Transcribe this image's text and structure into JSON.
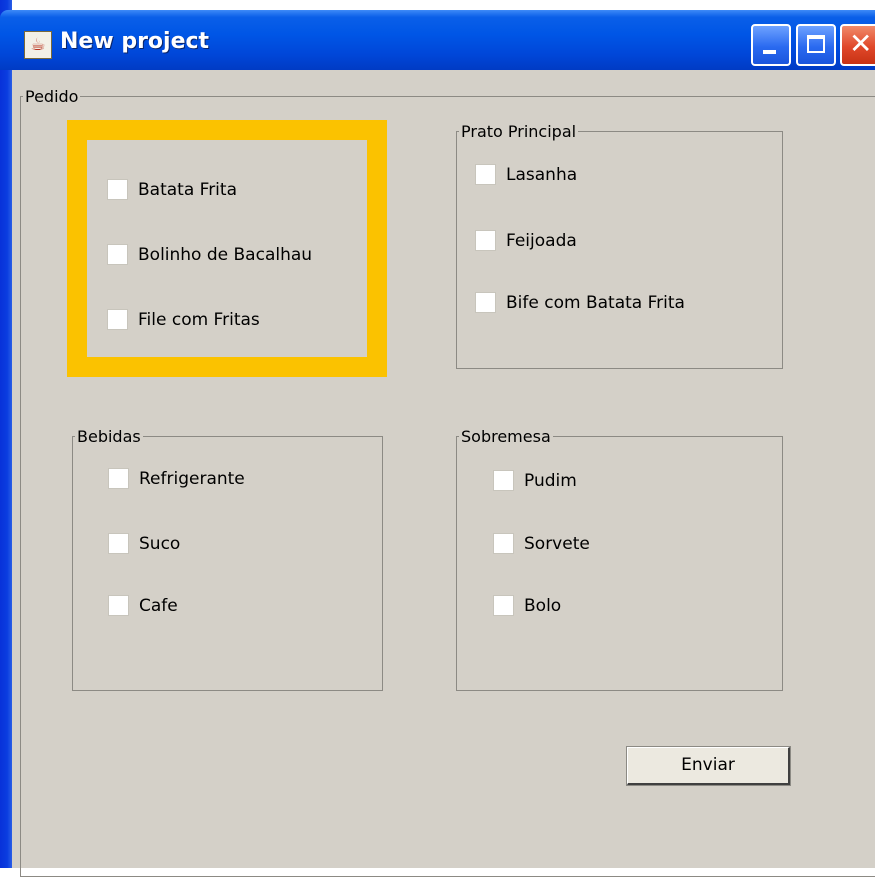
{
  "window": {
    "title": "New project",
    "icon": "java-cup-icon"
  },
  "groups": {
    "pedido": {
      "legend": "Pedido"
    },
    "entradas": {
      "items": [
        "Batata Frita",
        "Bolinho de Bacalhau",
        "File com Fritas"
      ]
    },
    "prato_principal": {
      "legend": "Prato Principal",
      "items": [
        "Lasanha",
        "Feijoada",
        "Bife com Batata Frita"
      ]
    },
    "bebidas": {
      "legend": "Bebidas",
      "items": [
        "Refrigerante",
        "Suco",
        "Cafe"
      ]
    },
    "sobremesa": {
      "legend": "Sobremesa",
      "items": [
        "Pudim",
        "Sorvete",
        "Bolo"
      ]
    }
  },
  "buttons": {
    "submit_label": "Enviar"
  },
  "colors": {
    "highlight": "#fbc200",
    "titlebar": "#0056e6",
    "panel": "#d4d0c8"
  }
}
